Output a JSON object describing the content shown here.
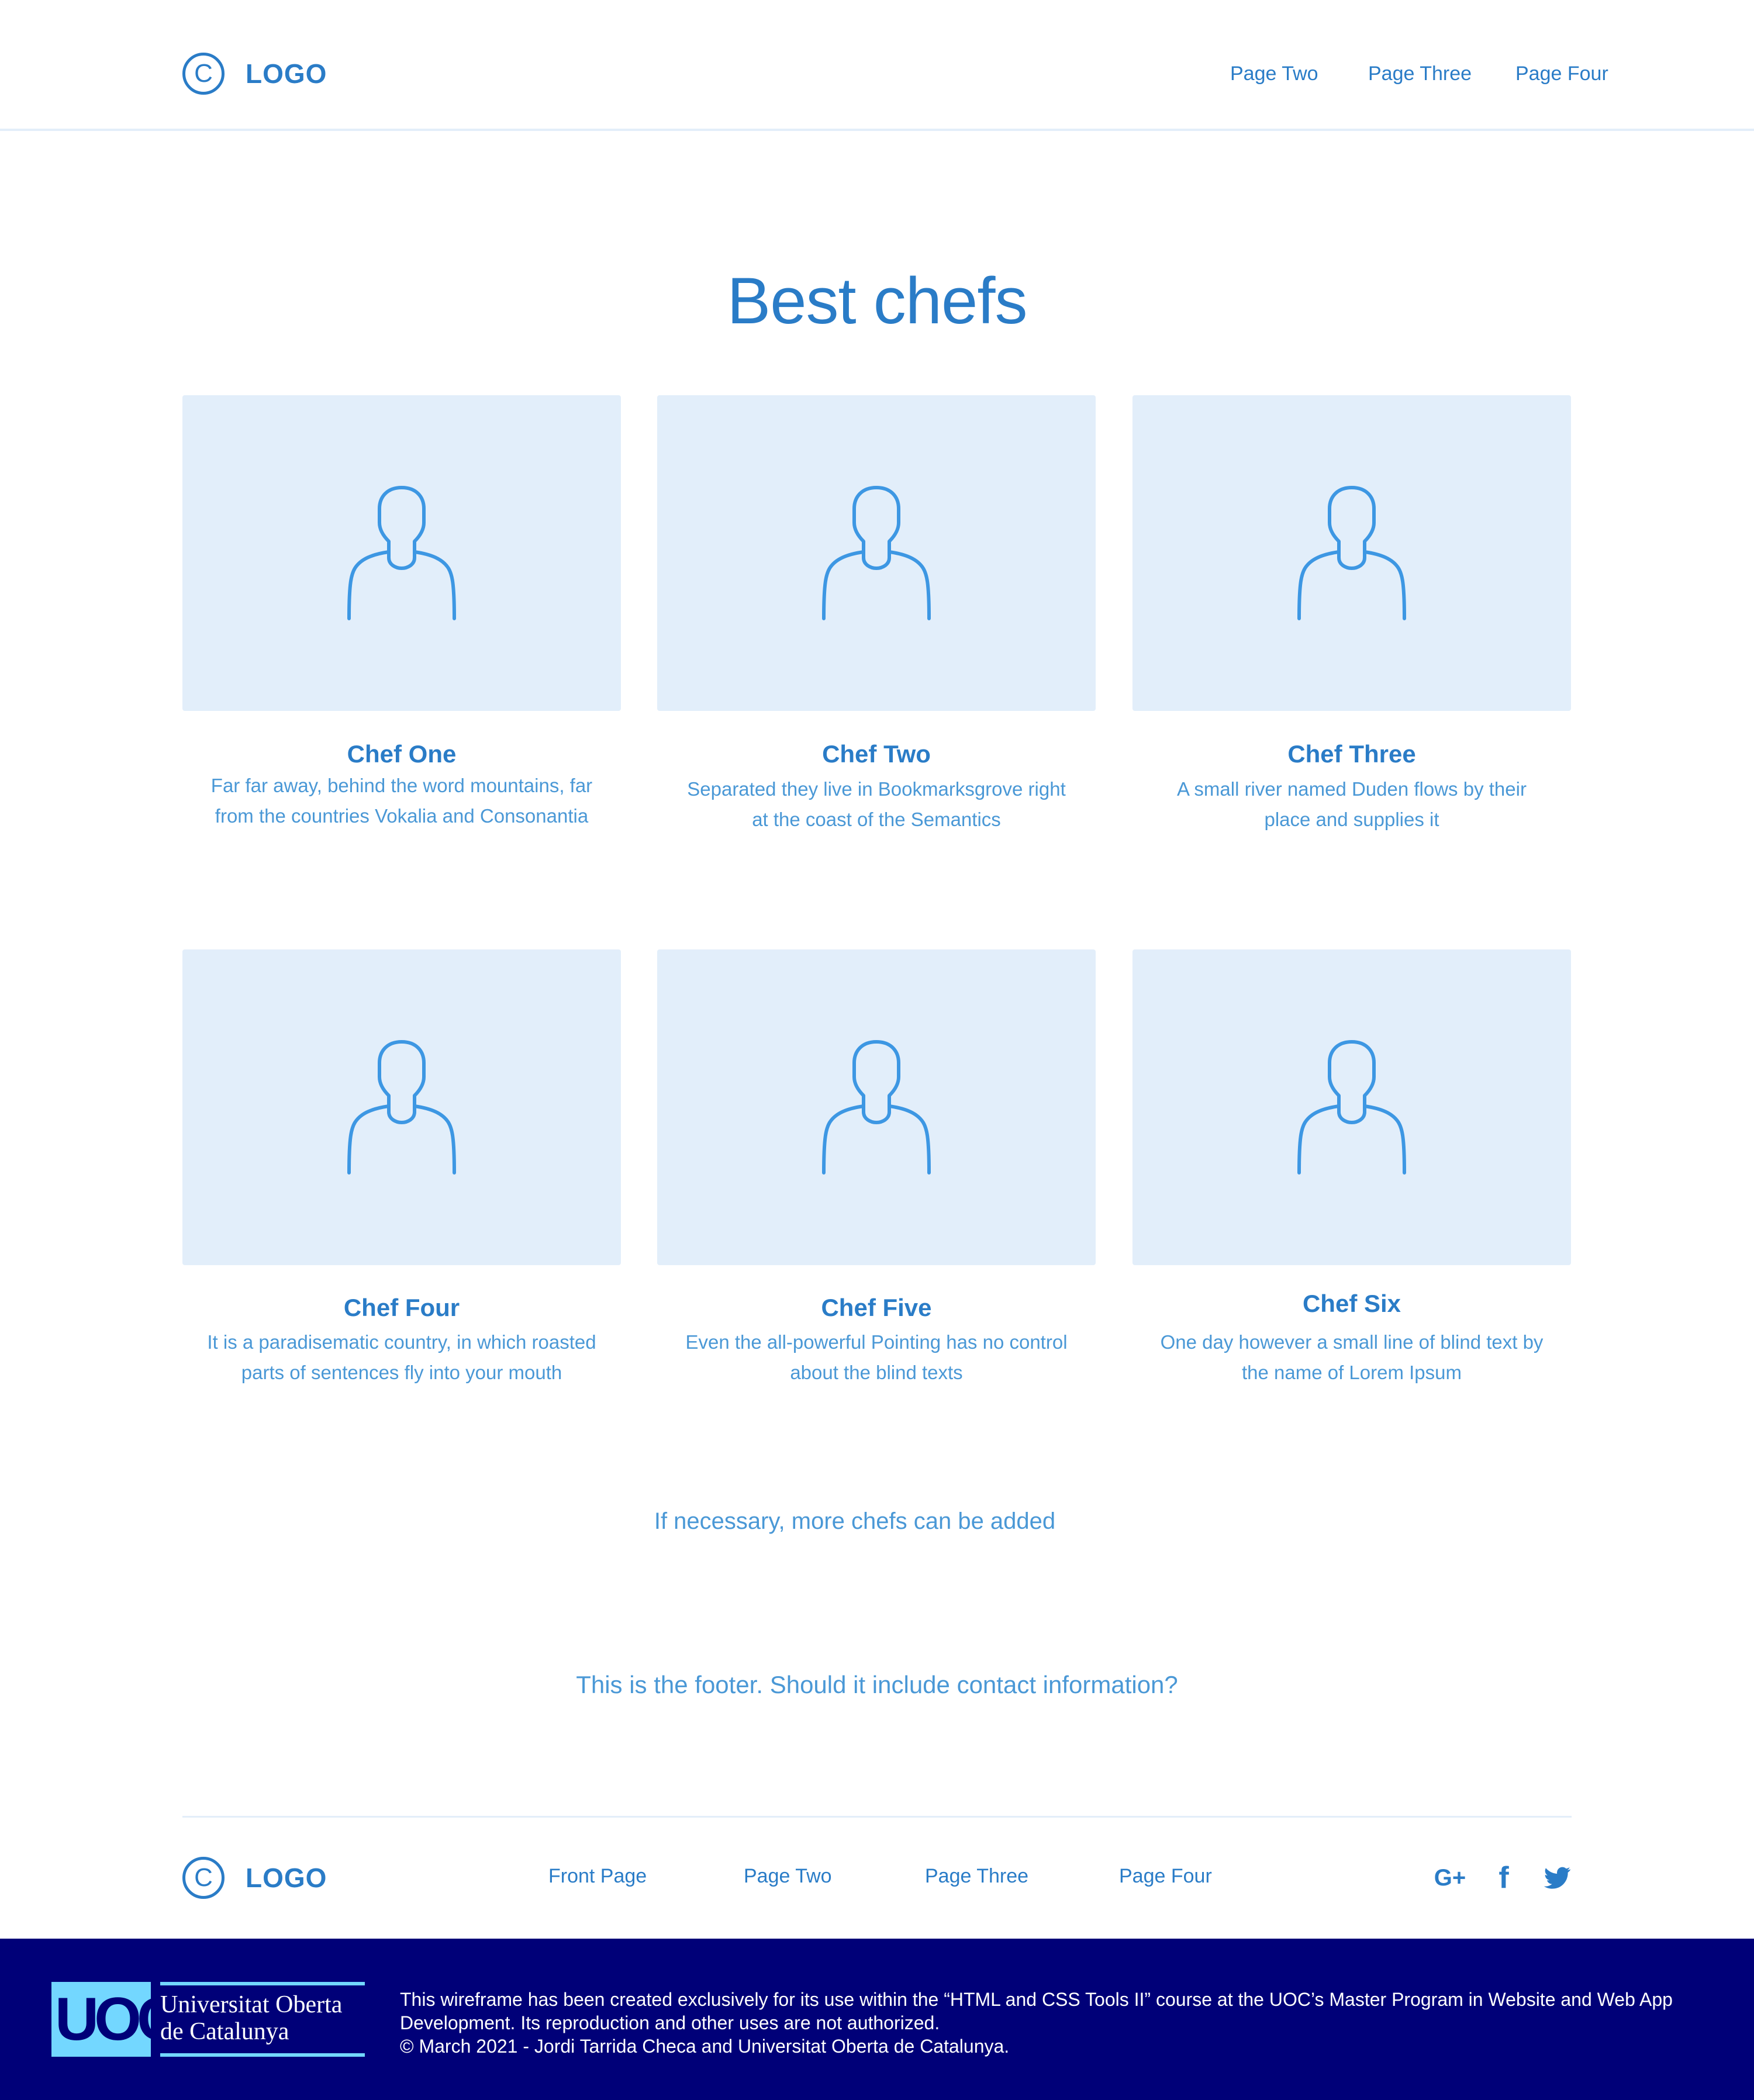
{
  "header": {
    "logo_mark": "C",
    "logo_text": "LOGO",
    "nav": [
      "Page Two",
      "Page Three",
      "Page Four"
    ]
  },
  "main": {
    "title": "Best chefs",
    "chefs": [
      {
        "name": "Chef One",
        "description": "Far far away, behind the word mountains, far from the countries Vokalia and Consonantia"
      },
      {
        "name": "Chef Two",
        "description": "Separated they live in Bookmarksgrove right at the coast of the Semantics"
      },
      {
        "name": "Chef Three",
        "description": "A small river named Duden flows by their place and supplies it"
      },
      {
        "name": "Chef Four",
        "description": "It is a paradisematic country, in which roasted parts of sentences fly into your mouth"
      },
      {
        "name": "Chef Five",
        "description": "Even the all-powerful Pointing has no control about the blind texts"
      },
      {
        "name": "Chef Six",
        "description": "One day however a small line of blind text by the name of Lorem Ipsum"
      }
    ],
    "more_text": "If necessary, more chefs can be added",
    "footer_note": "This is the footer. Should it include contact information?"
  },
  "footer": {
    "logo_mark": "C",
    "logo_text": "LOGO",
    "nav": [
      "Front Page",
      "Page Two",
      "Page Three",
      "Page Four"
    ],
    "social": [
      {
        "icon": "google-plus-icon",
        "glyph": "G+"
      },
      {
        "icon": "facebook-icon",
        "glyph": "f"
      },
      {
        "icon": "twitter-icon",
        "glyph": "twitter-bird"
      }
    ]
  },
  "band": {
    "uoc_mark": "UOC",
    "uoc_name_line1": "Universitat Oberta",
    "uoc_name_line2": "de Catalunya",
    "notice_line1": "This wireframe has been created exclusively for its use within the “HTML and CSS Tools II” course at the UOC’s Master Program in Website and Web App Development. Its reproduction and other uses are not authorized.",
    "notice_line2": "© March 2021 - Jordi Tarrida Checa and Universitat Oberta de Catalunya."
  },
  "colors": {
    "primary": "#2a7cc7",
    "card_bg": "#e2eefa",
    "icon_stroke": "#3d97e3",
    "band_bg": "#000078",
    "uoc_accent": "#73d7ff"
  }
}
